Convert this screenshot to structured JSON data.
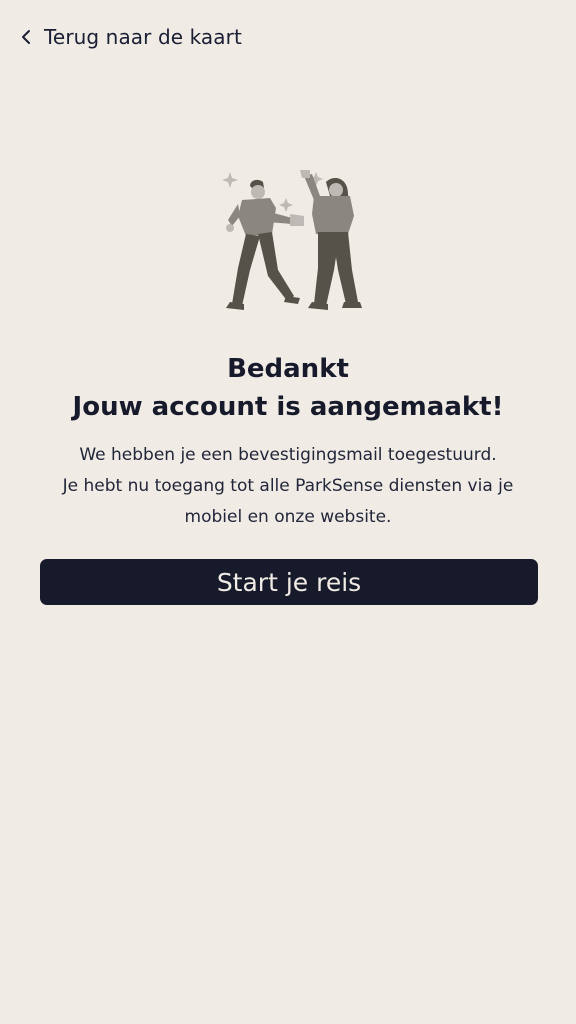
{
  "header": {
    "back_icon": "chevron-left-icon",
    "back_label": "Terug naar de kaart"
  },
  "illustration": {
    "name": "celebrating-people-illustration",
    "colors": {
      "primary": "#565249",
      "secondary": "#8a8680",
      "skin": "#bdb9b4",
      "sparkle": "#bdb9b4"
    }
  },
  "confirmation": {
    "title_line1": "Bedankt",
    "title_line2": "Jouw account is aangemaakt!",
    "body_line1": "We hebben je een bevestigingsmail toegestuurd.",
    "body_line2": "Je hebt nu toegang tot alle ParkSense diensten via je",
    "body_line3": "mobiel en onze website."
  },
  "actions": {
    "start_label": "Start je reis"
  },
  "colors": {
    "background": "#f0ebe4",
    "button_background": "#161a2b",
    "button_text": "#f0ebe4",
    "text": "#161a2b"
  }
}
